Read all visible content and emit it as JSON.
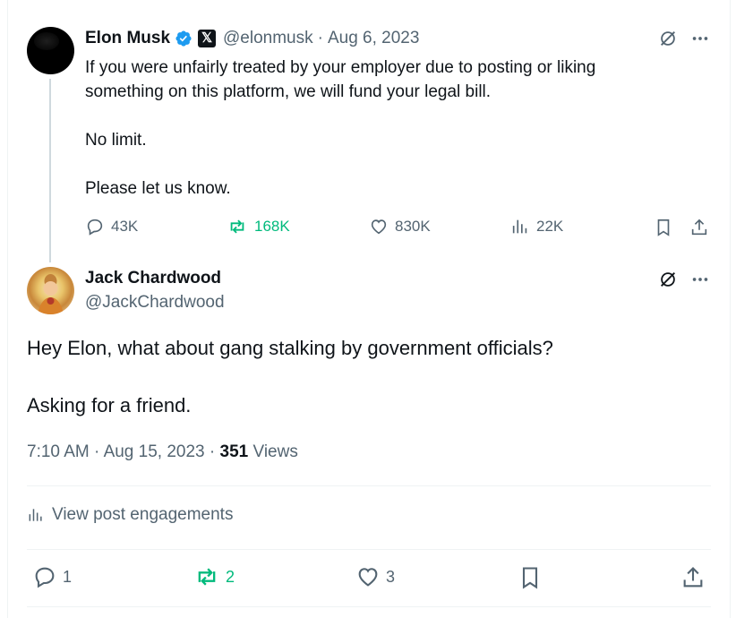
{
  "colors": {
    "text": "#0f1419",
    "secondary": "#536471",
    "green": "#00ba7c",
    "verified": "#1d9bf0",
    "divider": "#eff3f4"
  },
  "parent_post": {
    "name": "Elon Musk",
    "handle": "@elonmusk",
    "separator": "·",
    "date": "Aug 6, 2023",
    "text_line1": "If you were unfairly treated by your employer due to posting or liking",
    "text_line2": "something on this platform, we will fund your legal bill.",
    "text_line3": "No limit.",
    "text_line4": "Please let us know.",
    "replies": "43K",
    "reposts": "168K",
    "likes": "830K",
    "views": "22K"
  },
  "reply_post": {
    "name": "Jack Chardwood",
    "handle": "@JackChardwood",
    "text_line1": "Hey Elon, what about gang stalking by government officials?",
    "text_line2": "Asking for a friend.",
    "time": "7:10 AM",
    "separator1": "·",
    "date": "Aug 15, 2023",
    "separator2": "·",
    "views_count": "351",
    "views_label": "Views",
    "engagements_label": "View post engagements",
    "replies": "1",
    "reposts": "2",
    "likes": "3"
  },
  "icons": [
    "verified-badge-icon",
    "x-logo-icon",
    "grok-icon",
    "more-icon",
    "reply-icon",
    "repost-icon",
    "like-icon",
    "analytics-icon",
    "bookmark-icon",
    "share-icon"
  ]
}
